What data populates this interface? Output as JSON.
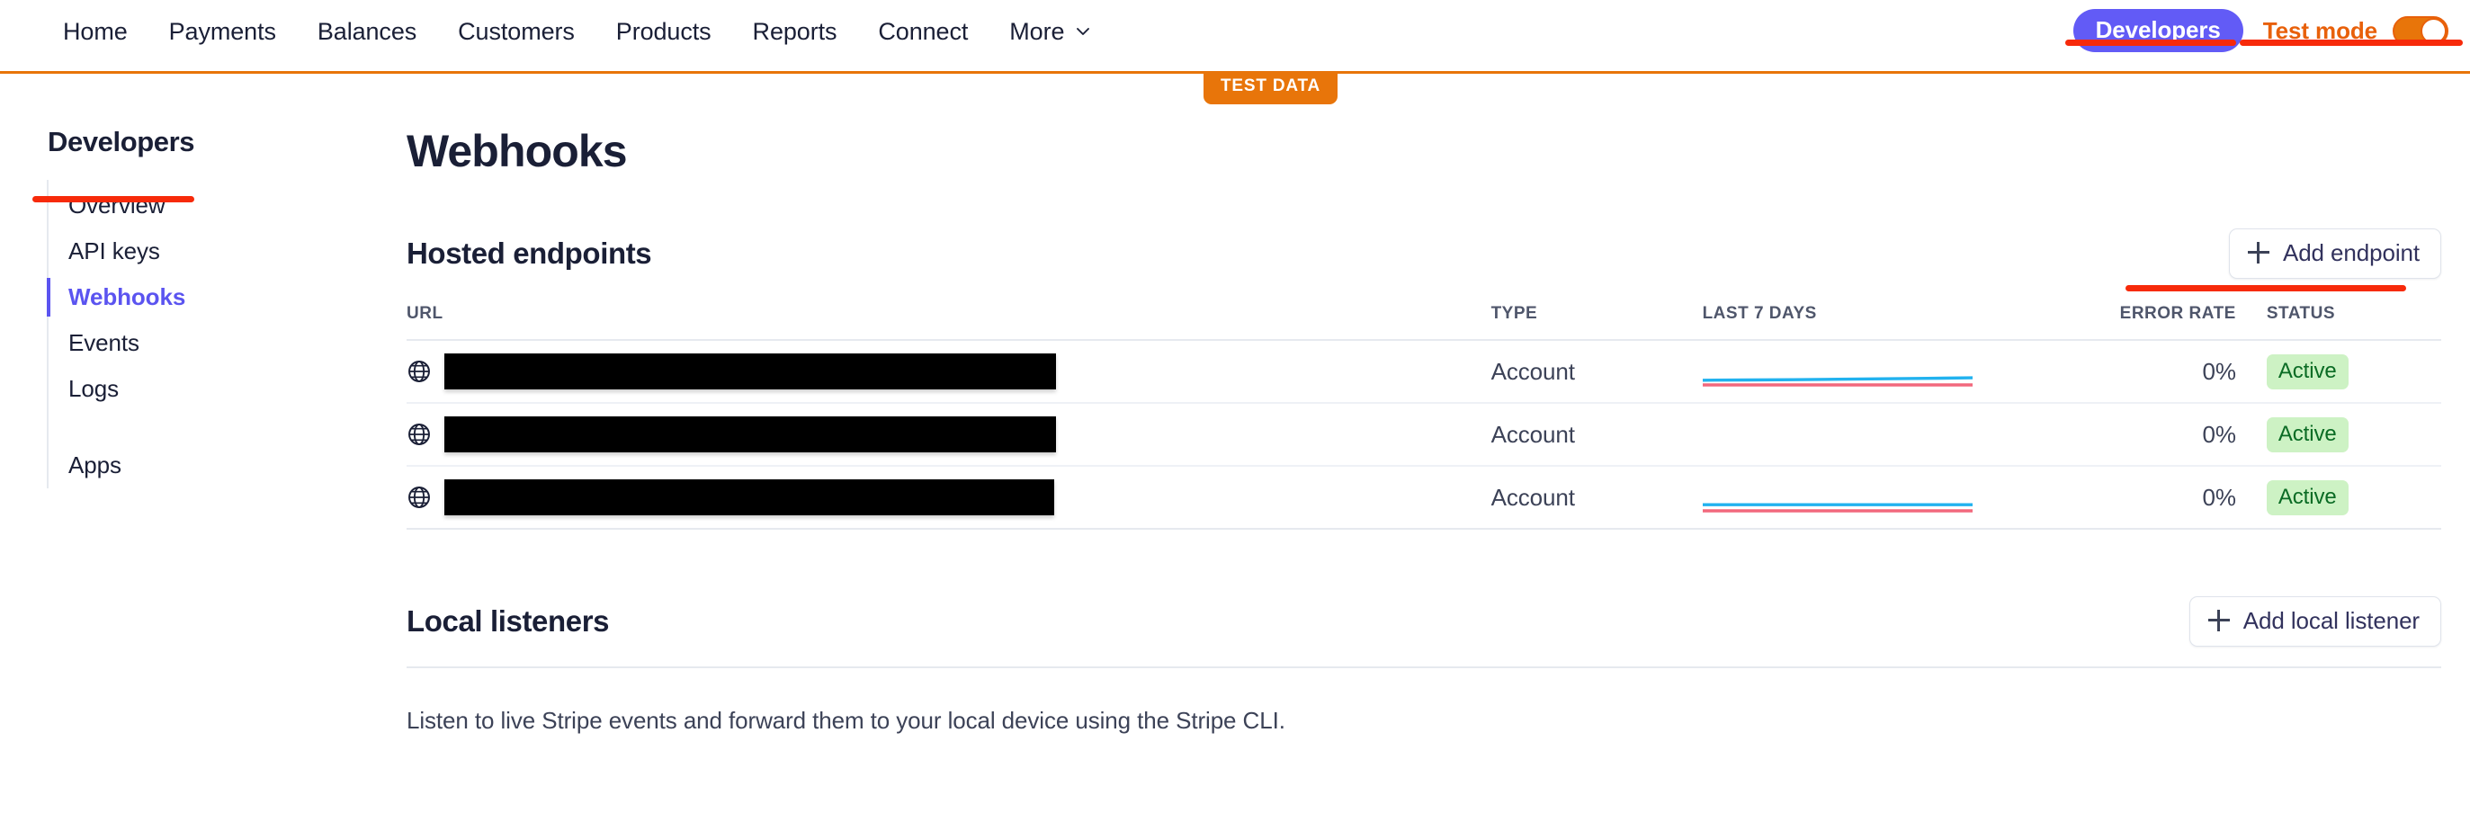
{
  "topnav": {
    "links": [
      {
        "label": "Home",
        "name": "nav-home"
      },
      {
        "label": "Payments",
        "name": "nav-payments"
      },
      {
        "label": "Balances",
        "name": "nav-balances"
      },
      {
        "label": "Customers",
        "name": "nav-customers"
      },
      {
        "label": "Products",
        "name": "nav-products"
      },
      {
        "label": "Reports",
        "name": "nav-reports"
      },
      {
        "label": "Connect",
        "name": "nav-connect"
      },
      {
        "label": "More",
        "name": "nav-more"
      }
    ],
    "developers_button": "Developers",
    "test_mode_label": "Test mode",
    "test_mode_on": true,
    "test_data_badge": "TEST DATA",
    "colors": {
      "developers_bg": "#625bf6",
      "test_mode": "#e8750a",
      "annotation": "#f72a0a"
    }
  },
  "sidebar": {
    "title": "Developers",
    "items": [
      {
        "label": "Overview",
        "active": false
      },
      {
        "label": "API keys",
        "active": false
      },
      {
        "label": "Webhooks",
        "active": true
      },
      {
        "label": "Events",
        "active": false
      },
      {
        "label": "Logs",
        "active": false
      }
    ],
    "secondary_items": [
      {
        "label": "Apps",
        "active": false
      }
    ],
    "active_color": "#5b54f0"
  },
  "main": {
    "page_title": "Webhooks",
    "hosted": {
      "title": "Hosted endpoints",
      "add_button": "Add endpoint",
      "columns": [
        "URL",
        "TYPE",
        "LAST 7 DAYS",
        "ERROR RATE",
        "STATUS"
      ],
      "rows": [
        {
          "url": "",
          "url_redacted": true,
          "redaction_width": 680,
          "type": "Account",
          "error_rate": "0%",
          "status": "Active",
          "sparkline": {
            "has_data": true,
            "success": [
              0.45,
              0.47,
              0.49,
              0.52,
              0.55,
              0.58,
              0.62
            ],
            "error": [
              0.0,
              0.0,
              0.0,
              0.0,
              0.0,
              0.0,
              0.0
            ]
          }
        },
        {
          "url": "",
          "url_redacted": true,
          "redaction_width": 680,
          "type": "Account",
          "error_rate": "0%",
          "status": "Active",
          "sparkline": {
            "has_data": false,
            "success": [],
            "error": []
          }
        },
        {
          "url": "",
          "url_redacted": true,
          "redaction_width": 678,
          "type": "Account",
          "error_rate": "0%",
          "status": "Active",
          "sparkline": {
            "has_data": true,
            "success": [
              0.55,
              0.55,
              0.55,
              0.55,
              0.55,
              0.55,
              0.55
            ],
            "error": [
              0.0,
              0.0,
              0.0,
              0.0,
              0.0,
              0.0,
              0.0
            ]
          }
        }
      ],
      "status_colors": {
        "active_bg": "#cdf2c4",
        "active_text": "#0a6b24"
      },
      "sparkline_colors": {
        "success": "#21b2ef",
        "error": "#f2687d"
      }
    },
    "local": {
      "title": "Local listeners",
      "add_button": "Add local listener",
      "description": "Listen to live Stripe events and forward them to your local device using the Stripe CLI."
    }
  },
  "annotations": [
    {
      "name": "annotation-developers",
      "target": "Developers"
    },
    {
      "name": "annotation-test-mode",
      "target": "Test mode"
    },
    {
      "name": "annotation-webhooks",
      "target": "Webhooks"
    },
    {
      "name": "annotation-add-endpoint",
      "target": "Add endpoint"
    }
  ]
}
